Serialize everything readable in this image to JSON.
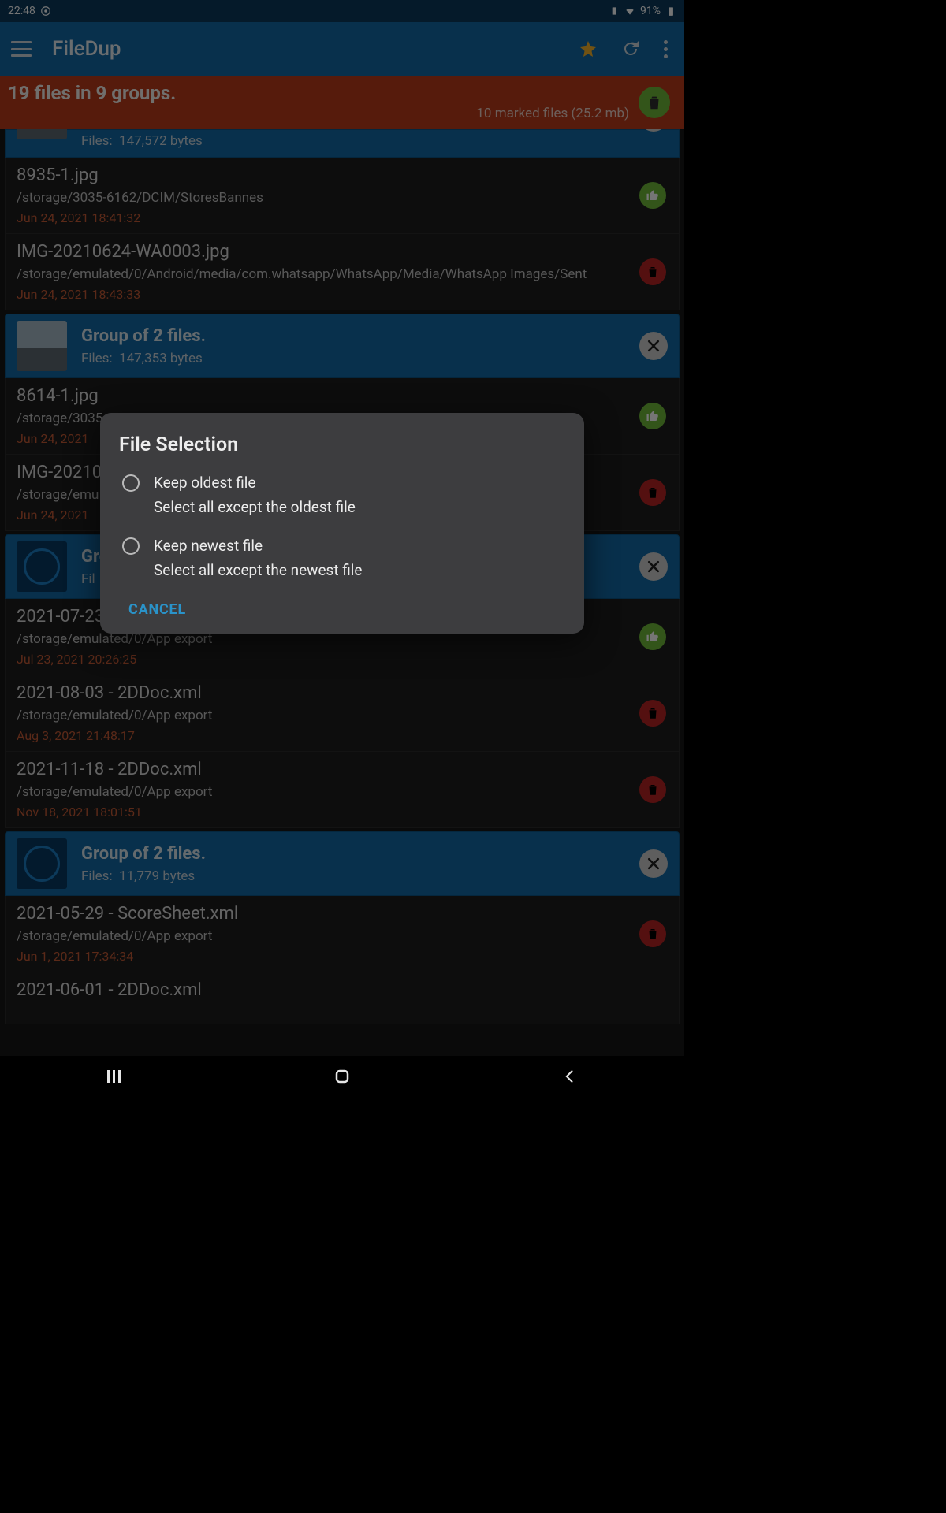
{
  "statusbar": {
    "time": "22:48",
    "battery_pct": "91%"
  },
  "appbar": {
    "title": "FileDup"
  },
  "summary": {
    "title": "19 files in 9 groups.",
    "subtitle": "10 marked files (25.2 mb)"
  },
  "dialog": {
    "title": "File Selection",
    "opt1_label": "Keep oldest file",
    "opt1_desc": "Select all except the oldest file",
    "opt2_label": "Keep newest file",
    "opt2_desc": "Select all except the newest file",
    "cancel": "CANCEL"
  },
  "groups": {
    "g0": {
      "files_label": "Files:",
      "size": "147,572 bytes"
    },
    "g1": {
      "title": "Group of 2 files.",
      "files_label": "Files:",
      "size": "147,353 bytes"
    },
    "g2": {
      "title": "Gro",
      "files_label": "Fil"
    },
    "g3": {
      "title": "Group of 2 files.",
      "files_label": "Files:",
      "size": "11,779 bytes"
    }
  },
  "files": {
    "f1": {
      "name": "8935-1.jpg",
      "path": "/storage/3035-6162/DCIM/StoresBannes",
      "date": "Jun 24, 2021 18:41:32"
    },
    "f2": {
      "name": "IMG-20210624-WA0003.jpg",
      "path": "/storage/emulated/0/Android/media/com.whatsapp/WhatsApp/Media/WhatsApp Images/Sent",
      "date": "Jun 24, 2021 18:43:33"
    },
    "f3": {
      "name": "8614-1.jpg",
      "path": "/storage/3035",
      "date": "Jun 24, 2021"
    },
    "f4": {
      "name": "IMG-20210",
      "path": "/storage/emu",
      "date": "Jun 24, 2021"
    },
    "f5": {
      "name": "2021-07-23",
      "path": "/storage/emulated/0/App export",
      "date": "Jul 23, 2021 20:26:25"
    },
    "f6": {
      "name": "2021-08-03 - 2DDoc.xml",
      "path": "/storage/emulated/0/App export",
      "date": "Aug 3, 2021 21:48:17"
    },
    "f7": {
      "name": "2021-11-18 - 2DDoc.xml",
      "path": "/storage/emulated/0/App export",
      "date": "Nov 18, 2021 18:01:51"
    },
    "f8": {
      "name": "2021-05-29 - ScoreSheet.xml",
      "path": "/storage/emulated/0/App export",
      "date": "Jun 1, 2021 17:34:34"
    },
    "f9": {
      "name": "2021-06-01 - 2DDoc.xml"
    }
  }
}
